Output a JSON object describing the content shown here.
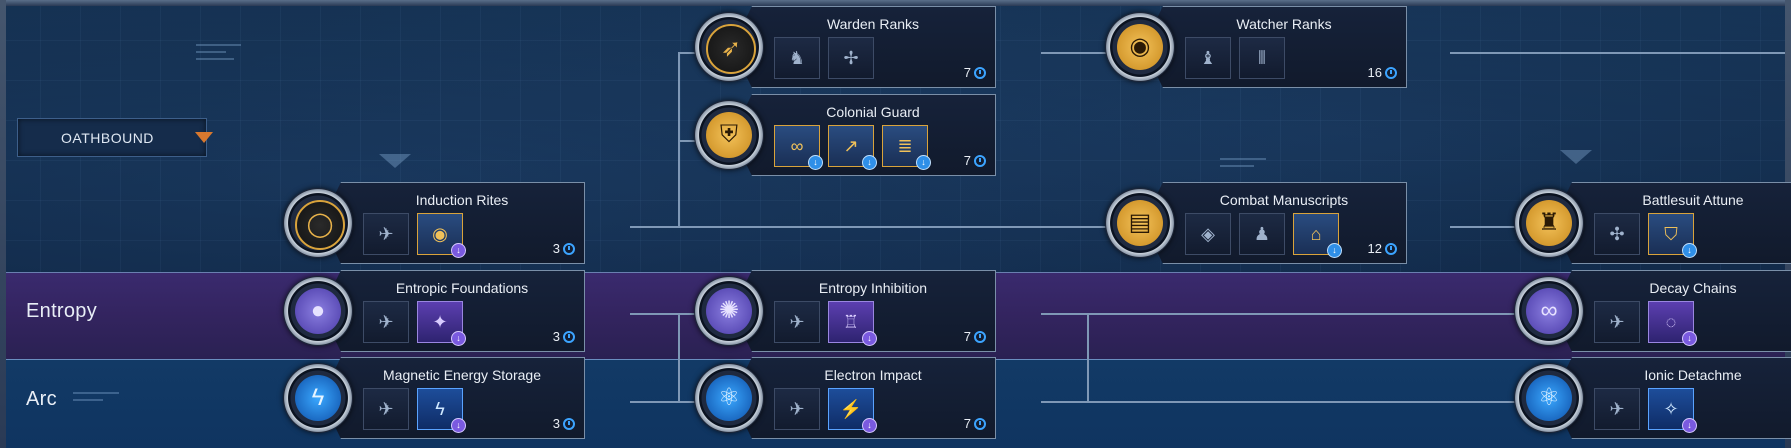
{
  "selector": {
    "value": "OATHBOUND"
  },
  "rows": {
    "entropy": "Entropy",
    "arc": "Arc"
  },
  "cards": [
    {
      "id": "warden-ranks",
      "title": "Warden Ranks",
      "cost": "7",
      "icon": "bow-icon",
      "badge_style": "gold-dark",
      "slots": [
        "unit-warden-icon",
        "unit-crossbow-icon"
      ]
    },
    {
      "id": "watcher-ranks",
      "title": "Watcher Ranks",
      "cost": "16",
      "icon": "eye-mask-icon",
      "badge_style": "gold",
      "slots": [
        "unit-watcher-icon",
        "claw-icon"
      ]
    },
    {
      "id": "colonial-guard",
      "title": "Colonial Guard",
      "cost": "7",
      "icon": "shield-lock-icon",
      "badge_style": "gold",
      "slots": [
        "rings-upgrade-icon",
        "arrow-up-upgrade-icon",
        "stack-upgrade-icon"
      ]
    },
    {
      "id": "induction-rites",
      "title": "Induction Rites",
      "cost": "3",
      "icon": "ring-icon",
      "badge_style": "gold-dark",
      "slots": [
        "ship-icon",
        "eye-sigil-upgrade-icon"
      ]
    },
    {
      "id": "combat-manuscripts",
      "title": "Combat Manuscripts",
      "cost": "12",
      "icon": "book-icon",
      "badge_style": "gold",
      "slots": [
        "vehicle-icon",
        "mech-icon",
        "hall-upgrade-icon"
      ]
    },
    {
      "id": "battlesuit-attunement",
      "title": "Battlesuit Attune",
      "cost": "",
      "icon": "battlesuit-icon",
      "badge_style": "gold",
      "slots": [
        "crab-icon",
        "armor-upgrade-icon"
      ]
    },
    {
      "id": "entropic-foundations",
      "title": "Entropic Foundations",
      "cost": "3",
      "icon": "orb-cluster-icon",
      "badge_style": "purple",
      "slots": [
        "insect-ship-icon",
        "entropy-bolt-upgrade-icon"
      ]
    },
    {
      "id": "entropy-inhibition",
      "title": "Entropy Inhibition",
      "cost": "7",
      "icon": "implosion-icon",
      "badge_style": "purple",
      "slots": [
        "jet-icon",
        "entropy-tower-upgrade-icon"
      ]
    },
    {
      "id": "decay-chains",
      "title": "Decay Chains",
      "cost": "",
      "icon": "chain-orbs-icon",
      "badge_style": "purple",
      "slots": [
        "drone-icon",
        "decay-upgrade-icon"
      ]
    },
    {
      "id": "magnetic-energy-storage",
      "title": "Magnetic Energy Storage",
      "cost": "3",
      "icon": "lightning-icon",
      "badge_style": "blue",
      "slots": [
        "hover-ship-icon",
        "arc-coil-upgrade-icon"
      ]
    },
    {
      "id": "electron-impact",
      "title": "Electron Impact",
      "cost": "7",
      "icon": "atom-icon",
      "badge_style": "blue",
      "slots": [
        "wing-ship-icon",
        "arc-strike-upgrade-icon"
      ]
    },
    {
      "id": "ionic-detachment",
      "title": "Ionic Detachme",
      "cost": "",
      "icon": "atom-icon",
      "badge_style": "blue",
      "slots": [
        "pod-icon",
        "ion-upgrade-icon"
      ]
    }
  ]
}
